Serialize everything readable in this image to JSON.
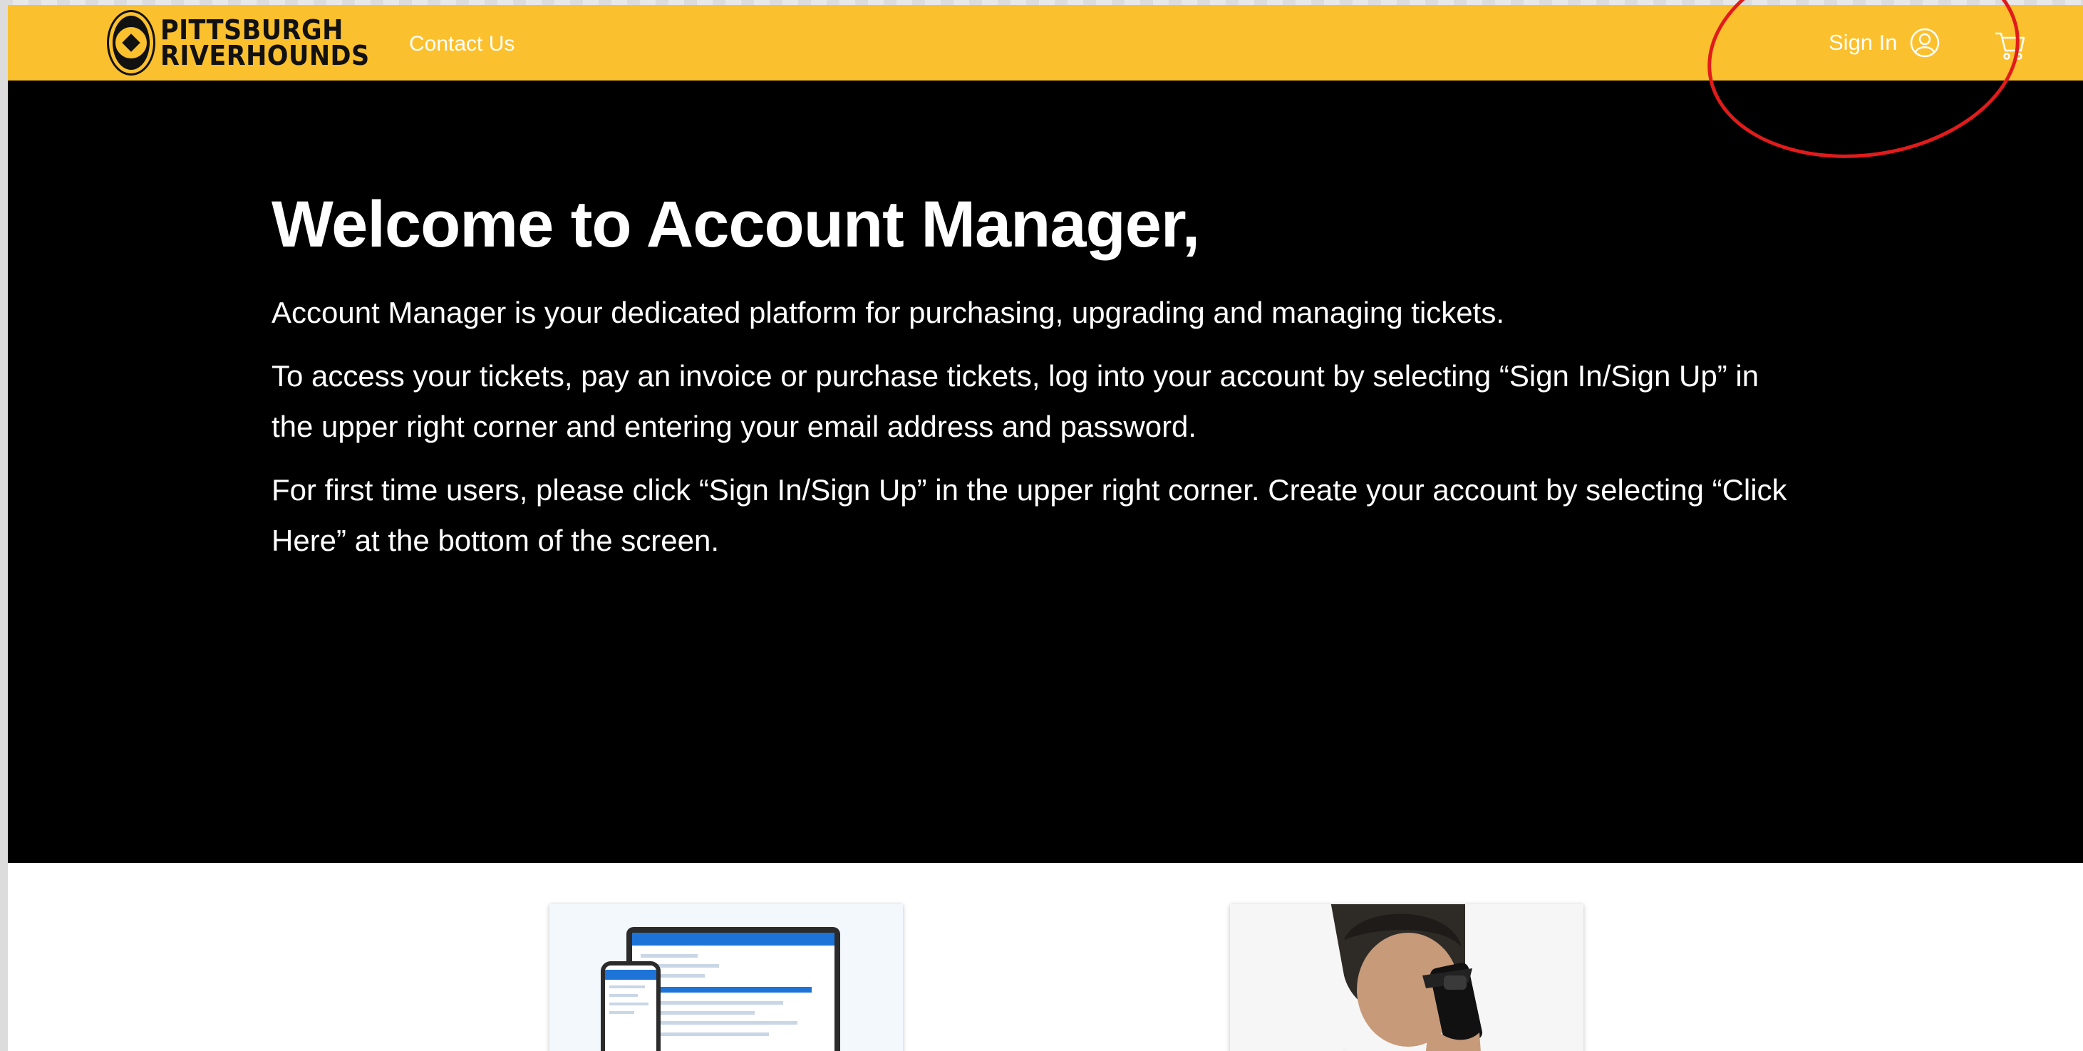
{
  "header": {
    "logo_line1": "PITTSBURGH",
    "logo_line2": "RIVERHOUNDS",
    "contact_label": "Contact Us",
    "signin_label": "Sign In",
    "brand_color": "#fbc02d",
    "icons": [
      "user-circle-icon",
      "cart-icon"
    ]
  },
  "hero": {
    "title": "Welcome to Account Manager,",
    "paragraphs": [
      "Account Manager is your dedicated platform for purchasing, upgrading and managing tickets.",
      "To access your tickets, pay an invoice or purchase tickets, log into your account by selecting “Sign In/Sign Up” in the upper right corner and entering your email address and password.",
      "For first time users, please click “Sign In/Sign Up” in the upper right corner. Create your account by selecting “Click Here” at the bottom of the screen."
    ]
  },
  "annotation": {
    "color": "#e11b1b"
  }
}
